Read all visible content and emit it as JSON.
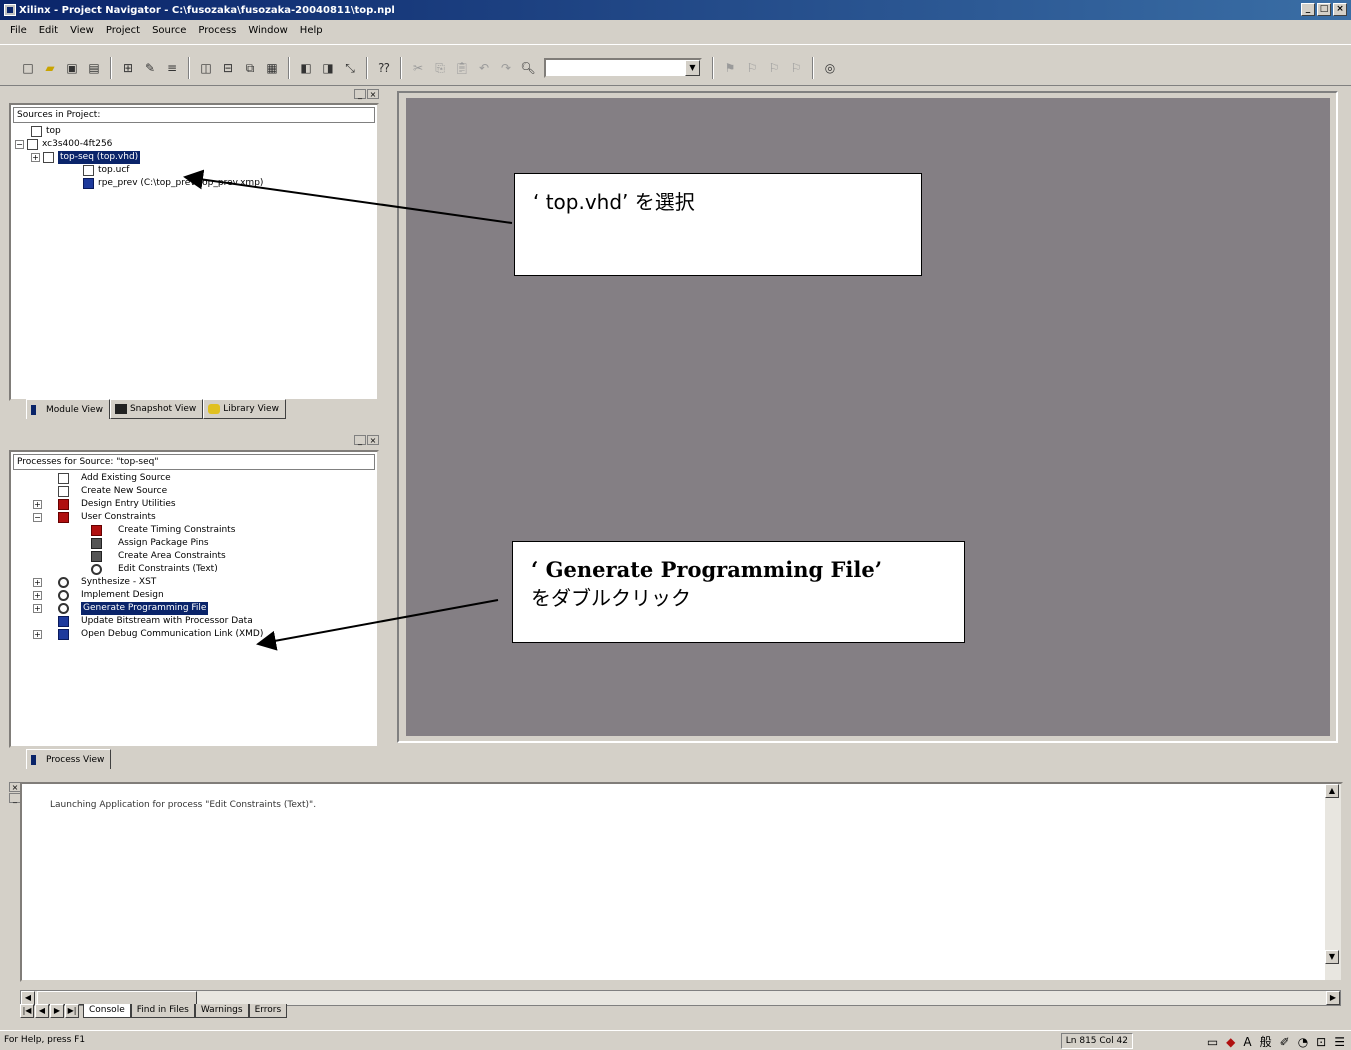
{
  "window": {
    "title": "Xilinx - Project Navigator - C:\\fusozaka\\fusozaka-20040811\\top.npl",
    "controls": [
      "_",
      "□",
      "×"
    ]
  },
  "menu": [
    "File",
    "Edit",
    "View",
    "Project",
    "Source",
    "Process",
    "Window",
    "Help"
  ],
  "toolbar": {
    "combo_value": "",
    "icons": [
      "new",
      "open",
      "save",
      "print",
      "add-source",
      "new-source",
      "properties",
      "windows",
      "window-tile",
      "window-cascade",
      "zoom",
      "doc",
      "panel",
      "panel2",
      "fit",
      "help",
      "cut",
      "copy",
      "paste",
      "undo",
      "redo",
      "find",
      "goto",
      "bookmark",
      "bookmark-next",
      "bookmark-prev",
      "bookmark-clear",
      "bulb"
    ]
  },
  "sources": {
    "header": "Sources in Project:",
    "items": [
      {
        "label": "top",
        "level": 0
      },
      {
        "label": "xc3s400-4ft256",
        "level": 0,
        "expander": "−"
      },
      {
        "label": "top-seq (top.vhd)",
        "level": 1,
        "expander": "+",
        "selected": true
      },
      {
        "label": "top.ucf",
        "level": 2
      },
      {
        "label": "rpe_prev (C:\\top_prev\\top_prev.xmp)",
        "level": 2
      }
    ],
    "tabs": [
      "Module View",
      "Snapshot View",
      "Library View"
    ]
  },
  "processes": {
    "header": "Processes for Source: \"top-seq\"",
    "items": [
      {
        "label": "Add Existing Source",
        "level": 0
      },
      {
        "label": "Create New Source",
        "level": 0
      },
      {
        "label": "Design Entry Utilities",
        "level": 0,
        "expander": "+"
      },
      {
        "label": "User Constraints",
        "level": 0,
        "expander": "−"
      },
      {
        "label": "Create Timing Constraints",
        "level": 1
      },
      {
        "label": "Assign Package Pins",
        "level": 1
      },
      {
        "label": "Create Area Constraints",
        "level": 1
      },
      {
        "label": "Edit Constraints (Text)",
        "level": 1
      },
      {
        "label": "Synthesize - XST",
        "level": 0,
        "expander": "+"
      },
      {
        "label": "Implement Design",
        "level": 0,
        "expander": "+"
      },
      {
        "label": "Generate Programming File",
        "level": 0,
        "expander": "+",
        "selected": true
      },
      {
        "label": "Update Bitstream with Processor Data",
        "level": 0
      },
      {
        "label": "Open Debug Communication Link (XMD)",
        "level": 0,
        "expander": "+"
      }
    ],
    "tabs": [
      "Process View"
    ]
  },
  "callouts": {
    "select_top": {
      "line1": "‘ top.vhd’ を選択"
    },
    "generate": {
      "line1": "‘ Generate Programming File’",
      "line2": "をダブルクリック"
    }
  },
  "console": {
    "text": "Launching Application for process \"Edit Constraints (Text)\".",
    "tabs": [
      "Console",
      "Find in Files",
      "Warnings",
      "Errors"
    ]
  },
  "status": {
    "help": "For Help, press F1",
    "position": "Ln 815 Col 42"
  }
}
